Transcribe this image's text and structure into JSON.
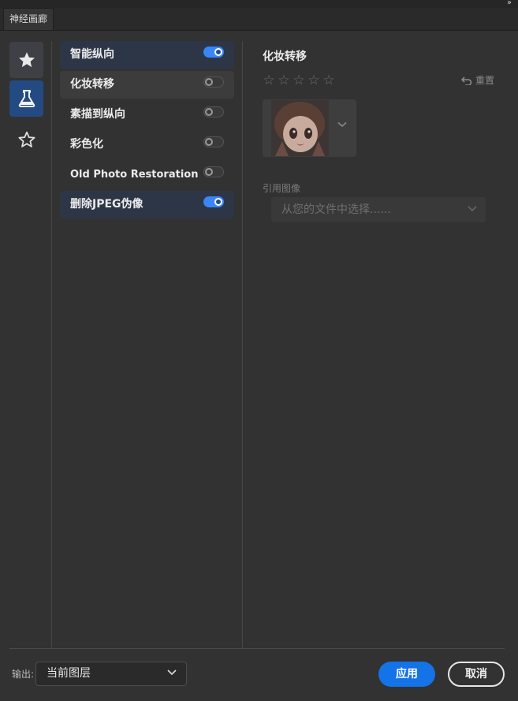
{
  "window": {
    "tab_label": "神经画廊",
    "collapse_glyph": "››"
  },
  "categories": [
    {
      "name": "featured",
      "icon": "star-filled-icon",
      "active": false
    },
    {
      "name": "beta",
      "icon": "flask-icon",
      "active": true
    },
    {
      "name": "wait-list",
      "icon": "star-outline-icon",
      "active": false
    }
  ],
  "filters": [
    {
      "label": "智能纵向",
      "enabled": true,
      "state": "active"
    },
    {
      "label": "化妆转移",
      "enabled": false,
      "state": "selected"
    },
    {
      "label": "素描到纵向",
      "enabled": false,
      "state": "normal"
    },
    {
      "label": "彩色化",
      "enabled": false,
      "state": "normal"
    },
    {
      "label": "Old Photo Restoration",
      "enabled": false,
      "state": "normal"
    },
    {
      "label": "删除JPEG伪像",
      "enabled": true,
      "state": "active"
    }
  ],
  "panel": {
    "title": "化妆转移",
    "rating": {
      "stars_total": 5,
      "stars_filled": 0,
      "glyph": "☆"
    },
    "reset_label": "重置",
    "reference_image_label": "引用图像",
    "reference_select_placeholder": "从您的文件中选择......"
  },
  "footer": {
    "output_label": "输出:",
    "output_value": "当前图层",
    "apply_label": "应用",
    "cancel_label": "取消"
  },
  "colors": {
    "background": "#323232",
    "accent": "#1473e6",
    "toggle_on": "#3a86f5",
    "active_item": "#2d3646",
    "active_category": "#234a82"
  }
}
